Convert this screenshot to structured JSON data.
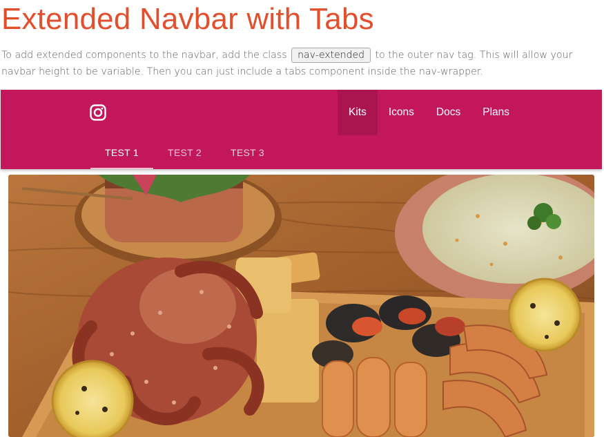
{
  "page": {
    "title": "Extended Navbar with Tabs",
    "intro_before": "To add extended components to the navbar, add the class",
    "intro_code": "nav-extended",
    "intro_after": "to the outer nav tag. This will allow your navbar height to be variable. Then you can just include a tabs component inside the nav-wrapper."
  },
  "navbar": {
    "background": "#c2185b",
    "brand_icon": "instagram-icon",
    "menu": [
      {
        "label": "Kits",
        "active": true
      },
      {
        "label": "Icons"
      },
      {
        "label": "Docs"
      },
      {
        "label": "Plans"
      }
    ],
    "tabs": [
      {
        "label": "TEST 1",
        "active": true
      },
      {
        "label": "TEST 2"
      },
      {
        "label": "TEST 3"
      }
    ]
  },
  "colors": {
    "title": "#e14f2d",
    "tab_indicator": "#f8bbd0"
  }
}
